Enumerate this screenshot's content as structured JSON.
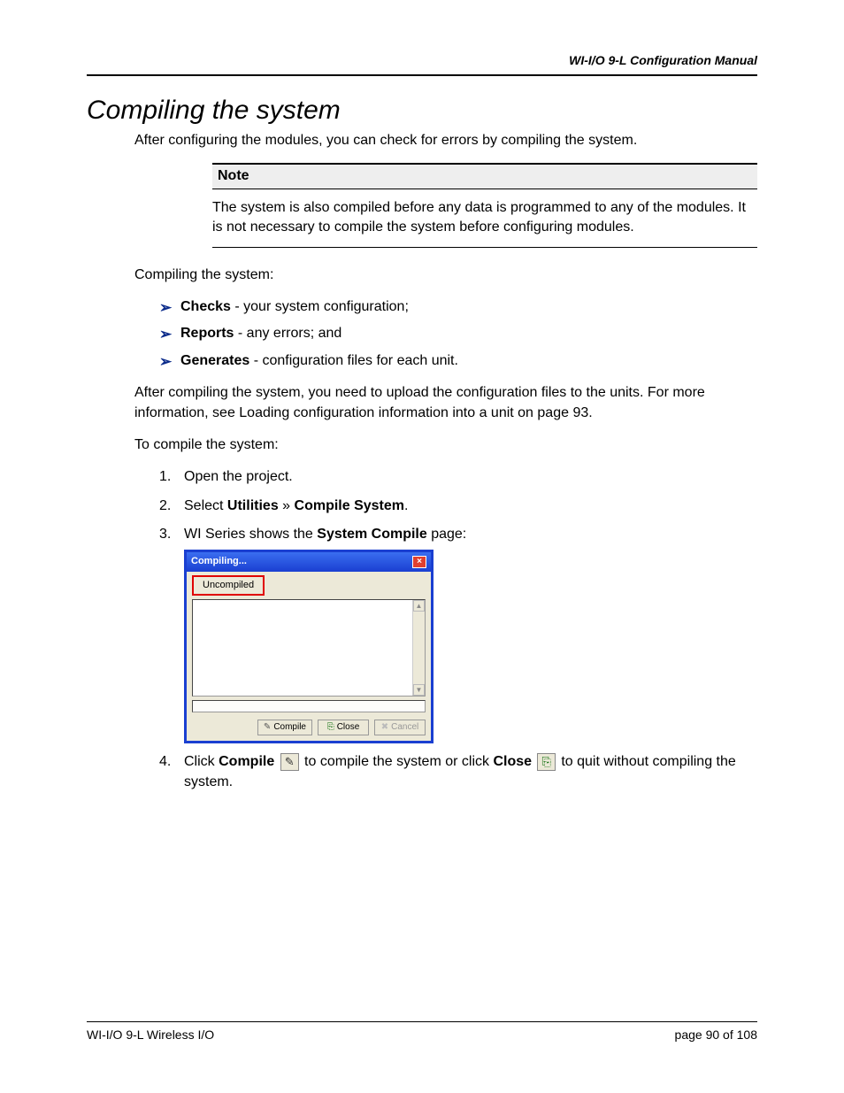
{
  "header": {
    "right": "WI-I/O 9-L Configuration Manual"
  },
  "title": "Compiling the system",
  "intro": "After configuring the modules, you can check for errors by compiling the system.",
  "note": {
    "heading": "Note",
    "body": "The system is also compiled before any data is programmed to any of the modules. It is not necessary to compile the system before configuring modules."
  },
  "para1": "Compiling the system:",
  "bullets": [
    {
      "bold": "Checks",
      "rest": " - your system configuration;"
    },
    {
      "bold": "Reports",
      "rest": " - any errors; and"
    },
    {
      "bold": "Generates",
      "rest": " - configuration files for each unit."
    }
  ],
  "para2": "After compiling the system, you need to upload the configuration files to the units. For more information, see Loading configuration information into a unit on page 93.",
  "para3": "To compile the system:",
  "steps": {
    "s1": "Open the project.",
    "s2_pre": "Select ",
    "s2_b1": "Utilities",
    "s2_mid": " » ",
    "s2_b2": "Compile System",
    "s2_post": ".",
    "s3_pre": "WI Series shows the ",
    "s3_b": "System Compile",
    "s3_post": " page:",
    "s4_pre": "Click ",
    "s4_b1": "Compile",
    "s4_mid1": " to compile the system or click ",
    "s4_b2": "Close",
    "s4_post": " to quit without compiling the system."
  },
  "dialog": {
    "title": "Compiling...",
    "status": "Uncompiled",
    "btn_compile": "Compile",
    "btn_close": "Close",
    "btn_cancel": "Cancel"
  },
  "footer": {
    "left": "WI-I/O 9-L Wireless I/O",
    "right_pre": "page  ",
    "right_cur": "90",
    "right_mid": " of ",
    "right_total": "108"
  }
}
